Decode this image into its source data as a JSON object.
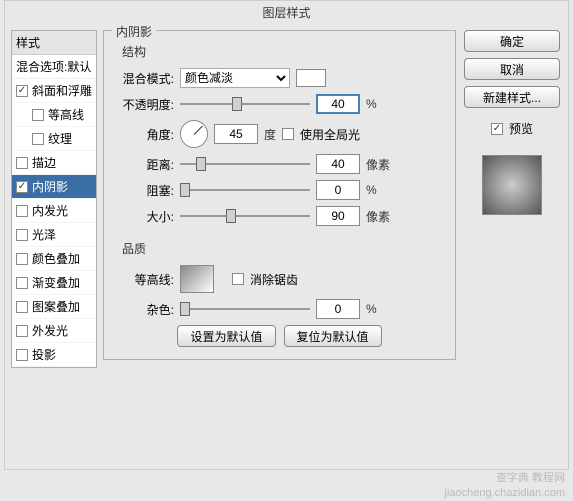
{
  "window_title": "图层样式",
  "styles_panel": {
    "header": "样式",
    "blend_options": "混合选项:默认",
    "items": [
      {
        "label": "斜面和浮雕",
        "checked": true,
        "indent": false,
        "selected": false
      },
      {
        "label": "等高线",
        "checked": false,
        "indent": true,
        "selected": false
      },
      {
        "label": "纹理",
        "checked": false,
        "indent": true,
        "selected": false
      },
      {
        "label": "描边",
        "checked": false,
        "indent": false,
        "selected": false
      },
      {
        "label": "内阴影",
        "checked": true,
        "indent": false,
        "selected": true
      },
      {
        "label": "内发光",
        "checked": false,
        "indent": false,
        "selected": false
      },
      {
        "label": "光泽",
        "checked": false,
        "indent": false,
        "selected": false
      },
      {
        "label": "颜色叠加",
        "checked": false,
        "indent": false,
        "selected": false
      },
      {
        "label": "渐变叠加",
        "checked": false,
        "indent": false,
        "selected": false
      },
      {
        "label": "图案叠加",
        "checked": false,
        "indent": false,
        "selected": false
      },
      {
        "label": "外发光",
        "checked": false,
        "indent": false,
        "selected": false
      },
      {
        "label": "投影",
        "checked": false,
        "indent": false,
        "selected": false
      }
    ]
  },
  "main": {
    "section_title": "内阴影",
    "structure_title": "结构",
    "blend_mode_label": "混合模式:",
    "blend_mode_value": "颜色减淡",
    "opacity_label": "不透明度:",
    "opacity_value": "40",
    "opacity_unit": "%",
    "angle_label": "角度:",
    "angle_value": "45",
    "angle_unit": "度",
    "global_light_label": "使用全局光",
    "distance_label": "距离:",
    "distance_value": "40",
    "distance_unit": "像素",
    "choke_label": "阻塞:",
    "choke_value": "0",
    "choke_unit": "%",
    "size_label": "大小:",
    "size_value": "90",
    "size_unit": "像素",
    "quality_title": "品质",
    "contour_label": "等高线:",
    "antialias_label": "消除锯齿",
    "noise_label": "杂色:",
    "noise_value": "0",
    "noise_unit": "%",
    "reset_default": "设置为默认值",
    "restore_default": "复位为默认值"
  },
  "right": {
    "ok": "确定",
    "cancel": "取消",
    "new_style": "新建样式...",
    "preview_label": "预览"
  },
  "watermark1": "查字典 教程网",
  "watermark2": "jiaocheng.chazidian.com"
}
